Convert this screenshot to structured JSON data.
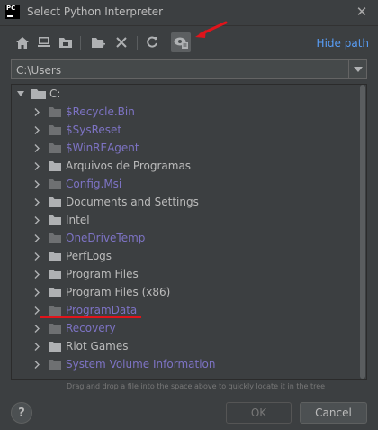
{
  "window": {
    "title": "Select Python Interpreter",
    "app_logo_text": "PC"
  },
  "toolbar": {
    "buttons": [
      {
        "icon": "home-icon"
      },
      {
        "icon": "desktop-icon"
      },
      {
        "icon": "project-folder-icon"
      },
      {
        "icon": "new-folder-icon"
      },
      {
        "icon": "delete-icon"
      },
      {
        "icon": "refresh-icon"
      },
      {
        "icon": "show-hidden-files-icon"
      }
    ],
    "hide_path_label": "Hide path"
  },
  "path": {
    "value": "C:\\Users"
  },
  "tree": {
    "root_label": "C:",
    "items": [
      {
        "label": "$Recycle.Bin",
        "hidden": true
      },
      {
        "label": "$SysReset",
        "hidden": true
      },
      {
        "label": "$WinREAgent",
        "hidden": true
      },
      {
        "label": "Arquivos de Programas",
        "hidden": false
      },
      {
        "label": "Config.Msi",
        "hidden": true
      },
      {
        "label": "Documents and Settings",
        "hidden": false
      },
      {
        "label": "Intel",
        "hidden": false
      },
      {
        "label": "OneDriveTemp",
        "hidden": true
      },
      {
        "label": "PerfLogs",
        "hidden": false
      },
      {
        "label": "Program Files",
        "hidden": false
      },
      {
        "label": "Program Files (x86)",
        "hidden": false
      },
      {
        "label": "ProgramData",
        "hidden": true
      },
      {
        "label": "Recovery",
        "hidden": true
      },
      {
        "label": "Riot Games",
        "hidden": false
      },
      {
        "label": "System Volume Information",
        "hidden": true
      }
    ]
  },
  "hint": "Drag and drop a file into the space above to quickly locate it in the tree",
  "footer": {
    "help_label": "?",
    "ok_label": "OK",
    "cancel_label": "Cancel"
  },
  "colors": {
    "background": "#3c3f41",
    "hidden_item": "#7d73c4",
    "link": "#589df6",
    "annotation_red": "#e0141b"
  }
}
